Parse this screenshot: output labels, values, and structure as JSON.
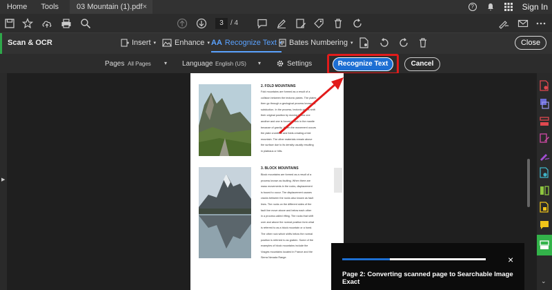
{
  "tabbar": {
    "home": "Home",
    "tools": "Tools",
    "doc_tab": "03 Mountain (1).pdf",
    "close": "×",
    "help": "?",
    "sign_in": "Sign In"
  },
  "toolbar": {
    "current_page": "3",
    "page_count": "/ 4"
  },
  "ocrbar": {
    "title": "Scan & OCR",
    "insert": "Insert",
    "enhance": "Enhance",
    "recognize_text": "Recognize Text",
    "bates_numbering": "Bates Numbering",
    "close": "Close"
  },
  "options": {
    "pages_label": "Pages",
    "pages_value": "All Pages",
    "language_label": "Language",
    "language_value": "English (US)",
    "settings": "Settings",
    "recognize_button": "Recognize Text",
    "cancel_button": "Cancel"
  },
  "document": {
    "section1_title": "2. FOLD MOUNTAINS",
    "section1_lines": [
      "Fold mountains are formed as a result of a",
      "collision between the tectonic plates. The plates",
      "then go through a geological process known as",
      "subduction. In the process, tectonic plates shift",
      "their original position by moving below one",
      "another and one is forced to sink in the mantle",
      "because of gravity. When the movement occurs",
      "the plate crumbles and folds creating a fold",
      "mountain. The other materials remain above",
      "the surface due to its density usually resulting",
      "in plateaus or hills."
    ],
    "section2_title": "3. BLOCK MOUNTAINS",
    "section2_lines": [
      "Block mountains are formed as a result of a",
      "process known as faulting. When there are",
      "mass movements in the rocks, displacement",
      "is bound to occur. The displacement causes",
      "cracks between the rocks also known as fault",
      "lines. The rocks on the different sides of the",
      "fault line move above and below each other",
      "in a process called rifting. The rocks that shift",
      "over and above the normal position form what",
      "is referred to as a block mountain or a horst.",
      "The other rock which shifts below the normal",
      "position is referred to as graben. Some of the",
      "examples of block mountains include the",
      "Vosges mountains located in France and the",
      "Sierra Nevada Range."
    ]
  },
  "progress": {
    "fraction": 0.33,
    "message": "Page 2: Converting scanned page to Searchable Image Exact",
    "close": "×"
  },
  "colors": {
    "accent": "#1d6fd3",
    "highlight": "#e21b1b",
    "ocr_green": "#2ea84a"
  }
}
